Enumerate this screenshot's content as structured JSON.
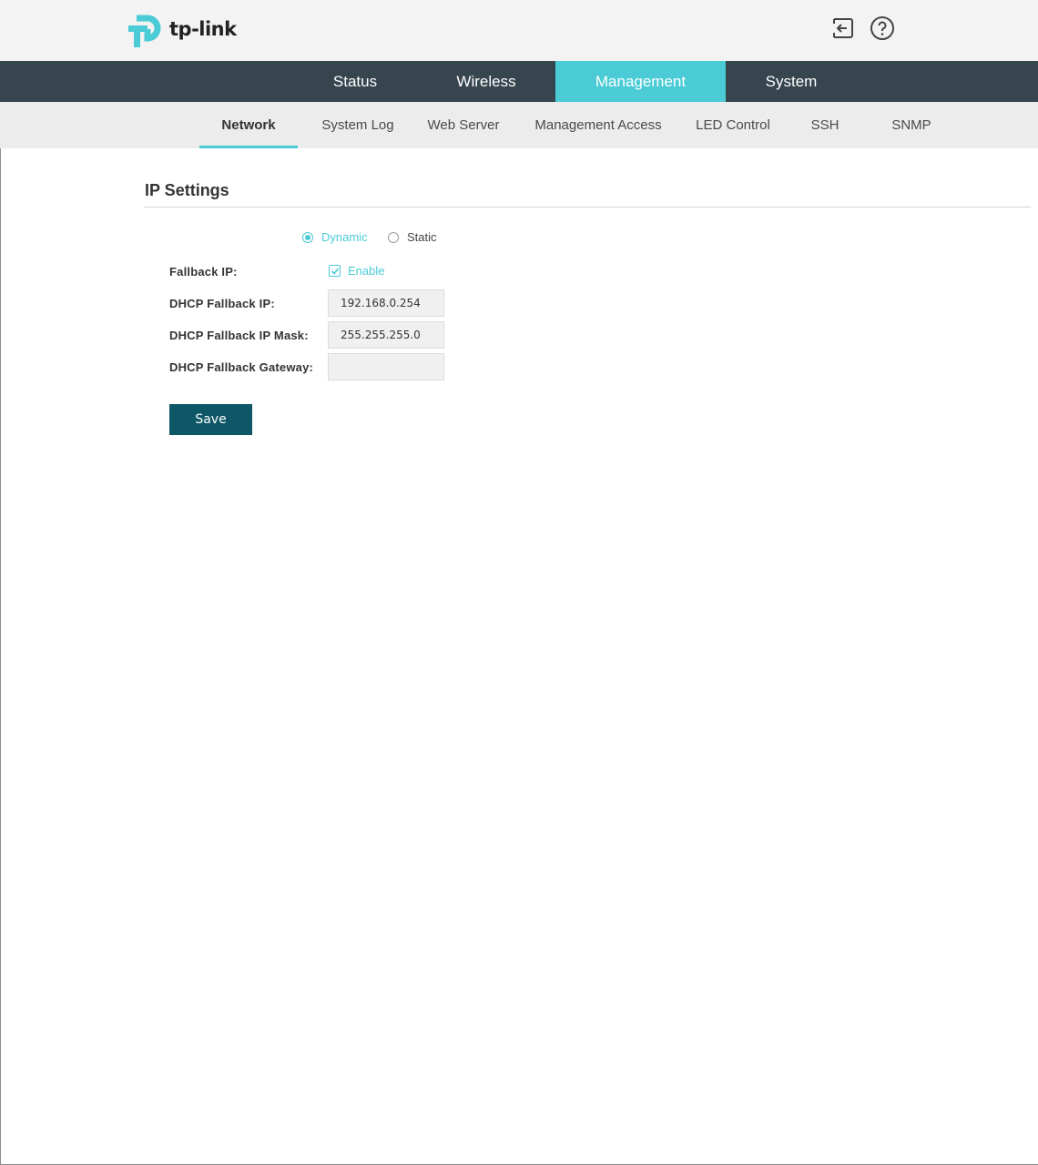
{
  "header": {
    "logo_text": "tp-link",
    "logo_color": "#4acbd6",
    "icons": [
      "logout-icon",
      "help-icon"
    ]
  },
  "main_nav": {
    "items": [
      {
        "label": "Status",
        "active": false
      },
      {
        "label": "Wireless",
        "active": false
      },
      {
        "label": "Management",
        "active": true
      },
      {
        "label": "System",
        "active": false
      }
    ]
  },
  "sub_nav": {
    "items": [
      {
        "label": "Network",
        "active": true
      },
      {
        "label": "System Log",
        "active": false
      },
      {
        "label": "Web Server",
        "active": false
      },
      {
        "label": "Management Access",
        "active": false
      },
      {
        "label": "LED Control",
        "active": false
      },
      {
        "label": "SSH",
        "active": false
      },
      {
        "label": "SNMP",
        "active": false
      }
    ]
  },
  "ip_settings": {
    "title": "IP Settings",
    "mode_options": [
      {
        "label": "Dynamic",
        "selected": true
      },
      {
        "label": "Static",
        "selected": false
      }
    ],
    "fallback_ip": {
      "label": "Fallback IP:",
      "checkbox_label": "Enable",
      "checked": true
    },
    "dhcp_fallback_ip": {
      "label": "DHCP Fallback IP:",
      "value": "192.168.0.254"
    },
    "dhcp_fallback_ip_mask": {
      "label": "DHCP Fallback IP Mask:",
      "value": "255.255.255.0"
    },
    "dhcp_fallback_gateway": {
      "label": "DHCP Fallback Gateway:",
      "value": ""
    },
    "save_label": "Save"
  },
  "colors": {
    "accent": "#4acbd6",
    "nav_bg": "#37454e",
    "subnav_bg": "#ececec",
    "save_button": "#0e5766"
  }
}
